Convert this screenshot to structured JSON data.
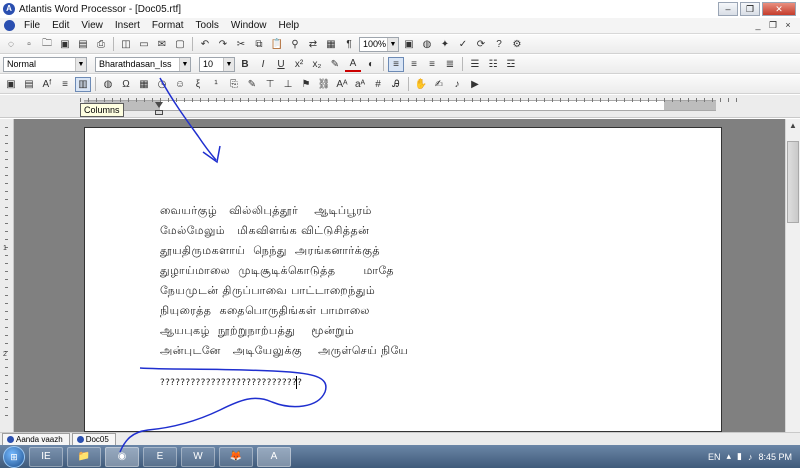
{
  "window": {
    "title": "Atlantis Word Processor - [Doc05.rtf]",
    "controls": [
      "–",
      "❐",
      "✕"
    ]
  },
  "menubar": {
    "items": [
      "File",
      "Edit",
      "View",
      "Insert",
      "Format",
      "Tools",
      "Window",
      "Help"
    ]
  },
  "toolbar": {
    "zoom": "100%",
    "style": "Normal",
    "font": "Bharathdasan_Iss",
    "size": "10",
    "bold_label": "B",
    "italic_label": "I",
    "underline_label": "U",
    "color_label": "A"
  },
  "tooltip": "Columns",
  "document": {
    "lines": [
      "வையர்குழ்   வில்லிபுத்தூர்    ஆடிப்பூரம்",
      "மேல்மேலும்   மிகவிளங்க விட்டுசித்தன்",
      "தூயதிருமகளாய்  நெந்து  அரங்கனார்க்குத்",
      "துழாய்மாலை  முடிசூடிக்கொடுத்த       மாதே",
      "நேயமுடன் திருப்பாவை பாட்டாறைந்தும்",
      "நியுரைத்த  கதைபொருதிங்கள் பாமாலை",
      "ஆயபுகழ்  நூற்றுநாற்பத்து    மூன்றும்",
      "அன்புடனே   அடியேலுக்கு    அருள்செய் நியே"
    ],
    "question_line": "????????????????????????????"
  },
  "tabs": [
    "Aanda vaazh",
    "Doc05"
  ],
  "taskbar": {
    "start_label": "⊞",
    "apps": [
      "IE",
      "📁",
      "◉",
      "E",
      "W",
      "🦊",
      "A"
    ],
    "lang": "EN",
    "time": "8:45 PM"
  },
  "vruler_numbers": [
    "1",
    "2"
  ]
}
